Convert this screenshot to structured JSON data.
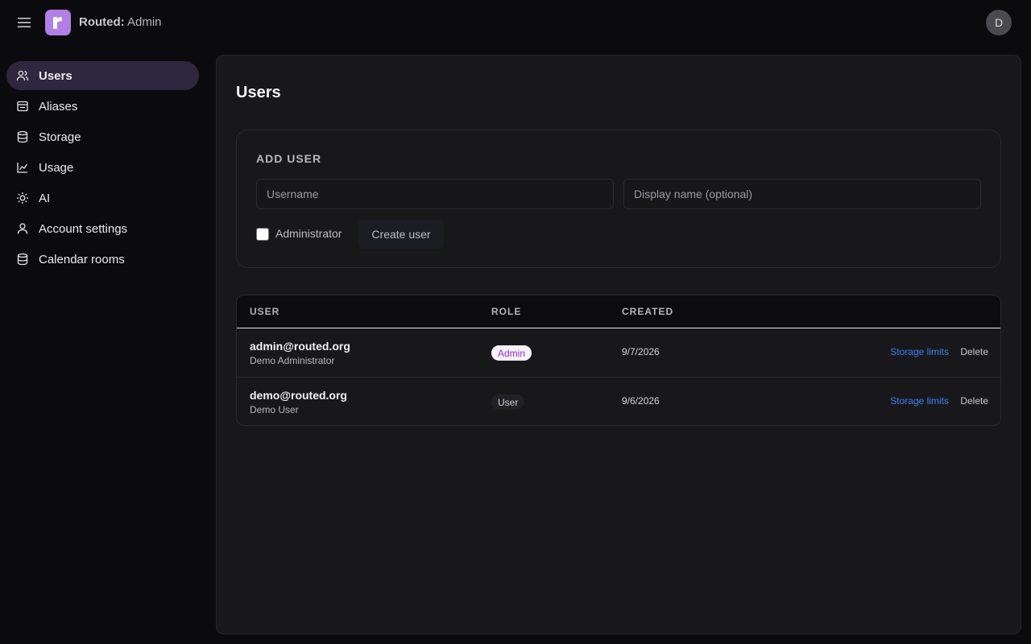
{
  "header": {
    "app_name": "Routed:",
    "section": "Admin",
    "avatar_initial": "D",
    "logo_letter": "r"
  },
  "sidebar": {
    "items": [
      {
        "label": "Users",
        "icon": "users-icon",
        "active": true
      },
      {
        "label": "Aliases",
        "icon": "alias-icon"
      },
      {
        "label": "Storage",
        "icon": "database-icon"
      },
      {
        "label": "Usage",
        "icon": "chart-line-icon"
      },
      {
        "label": "AI",
        "icon": "sun-icon"
      },
      {
        "label": "Account settings",
        "icon": "user-icon"
      },
      {
        "label": "Calendar rooms",
        "icon": "database-icon"
      }
    ]
  },
  "main": {
    "title": "Users",
    "add_user": {
      "title": "ADD USER",
      "username_placeholder": "Username",
      "display_name_placeholder": "Display name (optional)",
      "admin_label": "Administrator",
      "admin_checked": false,
      "create_label": "Create user"
    },
    "table": {
      "headers": {
        "user": "USER",
        "role": "ROLE",
        "created": "CREATED"
      },
      "rows": [
        {
          "email": "admin@routed.org",
          "name": "Demo Administrator",
          "role": "Admin",
          "created": "9/7/2026",
          "storage_link": "Storage limits",
          "delete_link": "Delete"
        },
        {
          "email": "demo@routed.org",
          "name": "Demo User",
          "role": "User",
          "created": "9/6/2026",
          "storage_link": "Storage limits",
          "delete_link": "Delete"
        }
      ]
    }
  },
  "colors": {
    "accent": "#b27ee9",
    "active_nav_bg": "#2f2640",
    "link": "#3b82f6",
    "admin_badge_text": "#8a2be2",
    "admin_badge_bg": "#fbf2ff"
  }
}
